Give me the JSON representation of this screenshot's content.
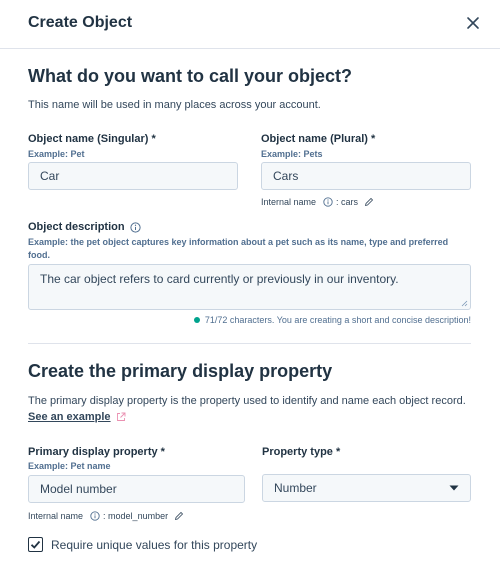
{
  "modal": {
    "title": "Create Object"
  },
  "name_section": {
    "heading": "What do you want to call your object?",
    "description": "This name will be used in many places across your account.",
    "singular": {
      "label": "Object name (Singular) *",
      "hint": "Example: Pet",
      "value": "Car"
    },
    "plural": {
      "label": "Object name (Plural) *",
      "hint": "Example: Pets",
      "value": "Cars"
    },
    "internal_name": {
      "label": "Internal name",
      "value": ": cars"
    }
  },
  "description_field": {
    "label": "Object description",
    "hint_line1": "Example: the pet object captures key information about a pet such as its name, type and preferred",
    "hint_line2": "food.",
    "value": "The car object refers to card currently or previously in our inventory.",
    "counter": "71/72 characters. You are creating a short and concise description!"
  },
  "display_section": {
    "heading": "Create the primary display property",
    "description": "The primary display property is the property used to identify and name each object record.",
    "link_text": "See an example",
    "primary": {
      "label": "Primary display property *",
      "hint": "Example: Pet name",
      "value": "Model number"
    },
    "property_type": {
      "label": "Property type *",
      "selected": "Number"
    },
    "internal_name": {
      "label": "Internal name",
      "value": ": model_number"
    },
    "unique_label": "Require unique values for this property",
    "unique_checked": true
  },
  "icons": [
    "close-icon",
    "info-icon",
    "pencil-icon",
    "external-link-icon",
    "caret-down-icon",
    "checkmark-icon",
    "resize-handle-icon"
  ],
  "colors": {
    "text": "#33475b",
    "heading": "#213343",
    "border": "#cbd6e2",
    "input_bg": "#f5f8fa",
    "success": "#00a38d"
  }
}
